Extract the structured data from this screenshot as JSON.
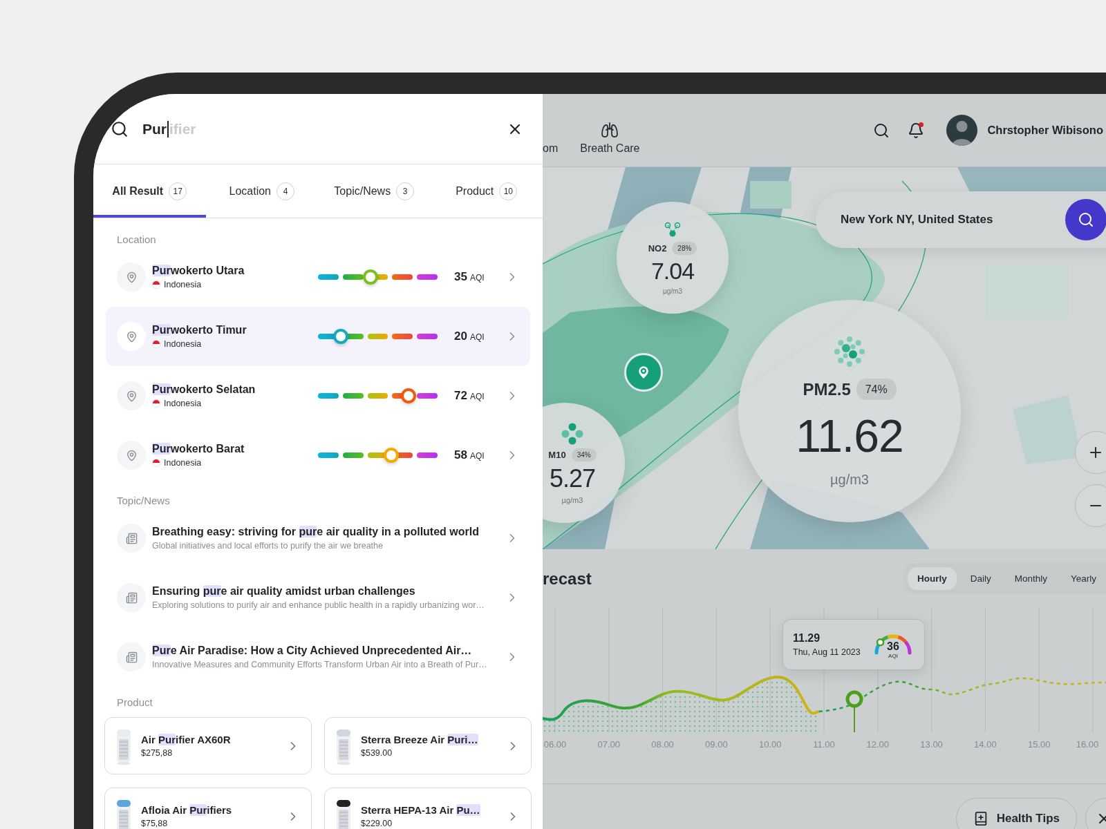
{
  "search": {
    "query": "Pur",
    "suggestion": "ifier"
  },
  "tabs": [
    {
      "label": "All Result",
      "count": "17",
      "selected": true
    },
    {
      "label": "Location",
      "count": "4",
      "selected": false
    },
    {
      "label": "Topic/News",
      "count": "3",
      "selected": false
    },
    {
      "label": "Product",
      "count": "10",
      "selected": false
    }
  ],
  "location_section": {
    "title": "Location",
    "items": [
      {
        "name": [
          {
            "text": "Pur",
            "highlight": true
          },
          {
            "text": "wokerto Utara",
            "highlight": false
          }
        ],
        "country": "Indonesia",
        "level": 0.44,
        "aqi": "35",
        "unit": "AQI",
        "selected": false
      },
      {
        "name": [
          {
            "text": "Pur",
            "highlight": true
          },
          {
            "text": "wokerto Timur",
            "highlight": false
          }
        ],
        "country": "Indonesia",
        "level": 0.19,
        "aqi": "20",
        "unit": "AQI",
        "selected": true
      },
      {
        "name": [
          {
            "text": "Pur",
            "highlight": true
          },
          {
            "text": "wokerto Selatan",
            "highlight": false
          }
        ],
        "country": "Indonesia",
        "level": 0.76,
        "aqi": "72",
        "unit": "AQI",
        "selected": false
      },
      {
        "name": [
          {
            "text": "Pur",
            "highlight": true
          },
          {
            "text": "wokerto Barat",
            "highlight": false
          }
        ],
        "country": "Indonesia",
        "level": 0.61,
        "aqi": "58",
        "unit": "AQI",
        "selected": false
      }
    ]
  },
  "news_section": {
    "title": "Topic/News",
    "items": [
      {
        "title": [
          {
            "text": "Breathing easy: striving for ",
            "highlight": false
          },
          {
            "text": "pur",
            "highlight": true
          },
          {
            "text": "e air quality in a polluted world",
            "highlight": false
          }
        ],
        "summary": "Global initiatives and local efforts to purify the air we breathe"
      },
      {
        "title": [
          {
            "text": "Ensuring ",
            "highlight": false
          },
          {
            "text": "pur",
            "highlight": true
          },
          {
            "text": "e air quality amidst urban challenges",
            "highlight": false
          }
        ],
        "summary": "Exploring solutions to purify air and enhance public health in a rapidly urbanizing wor…"
      },
      {
        "title": [
          {
            "text": "Pur",
            "highlight": true
          },
          {
            "text": "e Air Paradise: How a City Achieved Unprecedented Air…",
            "highlight": false
          }
        ],
        "summary": "Innovative Measures and Community Efforts Transform Urban Air into a Breath of Pur…"
      }
    ]
  },
  "product_section": {
    "title": "Product",
    "items": [
      {
        "name": [
          {
            "text": "Air ",
            "highlight": false
          },
          {
            "text": "Pur",
            "highlight": true
          },
          {
            "text": "ifier AX60R",
            "highlight": false
          }
        ],
        "price": "$275,88"
      },
      {
        "name": [
          {
            "text": "Sterra Breeze Air ",
            "highlight": false
          },
          {
            "text": "Puri…",
            "highlight": true
          }
        ],
        "price": "$539.00"
      },
      {
        "name": [
          {
            "text": "Afloia Air ",
            "highlight": false
          },
          {
            "text": "Pur",
            "highlight": true
          },
          {
            "text": "ifiers",
            "highlight": false
          }
        ],
        "price": "$75,88"
      },
      {
        "name": [
          {
            "text": "Sterra HEPA-13 Air ",
            "highlight": false
          },
          {
            "text": "Pu…",
            "highlight": true
          }
        ],
        "price": "$229.00"
      }
    ]
  },
  "nav": [
    {
      "label": "om",
      "kind": "text"
    },
    {
      "label": "Breath Care",
      "kind": "lungs"
    }
  ],
  "user": {
    "name": "Chrstopher Wibisono",
    "notification": true
  },
  "map": {
    "search_value": "New York NY, United States",
    "bubbles": [
      {
        "kind": "no2",
        "label": "NO2",
        "percent": "28%",
        "value": "7.04",
        "unit": "µg/m3"
      },
      {
        "kind": "pm10",
        "label": "M10",
        "percent": "34%",
        "value": "5.27",
        "unit": "µg/m3"
      },
      {
        "kind": "pm25",
        "label": "PM2.5",
        "percent": "74%",
        "value": "11.62",
        "unit": "µg/m3"
      }
    ]
  },
  "forecast": {
    "title": "recast",
    "periods": [
      {
        "label": "Hourly",
        "selected": true
      },
      {
        "label": "Daily",
        "selected": false
      },
      {
        "label": "Monthly",
        "selected": false
      },
      {
        "label": "Yearly",
        "selected": false
      }
    ],
    "x_labels": [
      "06.00",
      "07.00",
      "08.00",
      "09.00",
      "10.00",
      "11.00",
      "12.00",
      "13.00",
      "14.00",
      "15.00",
      "16.00"
    ],
    "tooltip": {
      "time": "11.29",
      "date": "Thu, Aug 11 2023",
      "aqi": "36",
      "unit": "AQI"
    }
  },
  "actions": [
    {
      "label": "Health Tips"
    }
  ]
}
